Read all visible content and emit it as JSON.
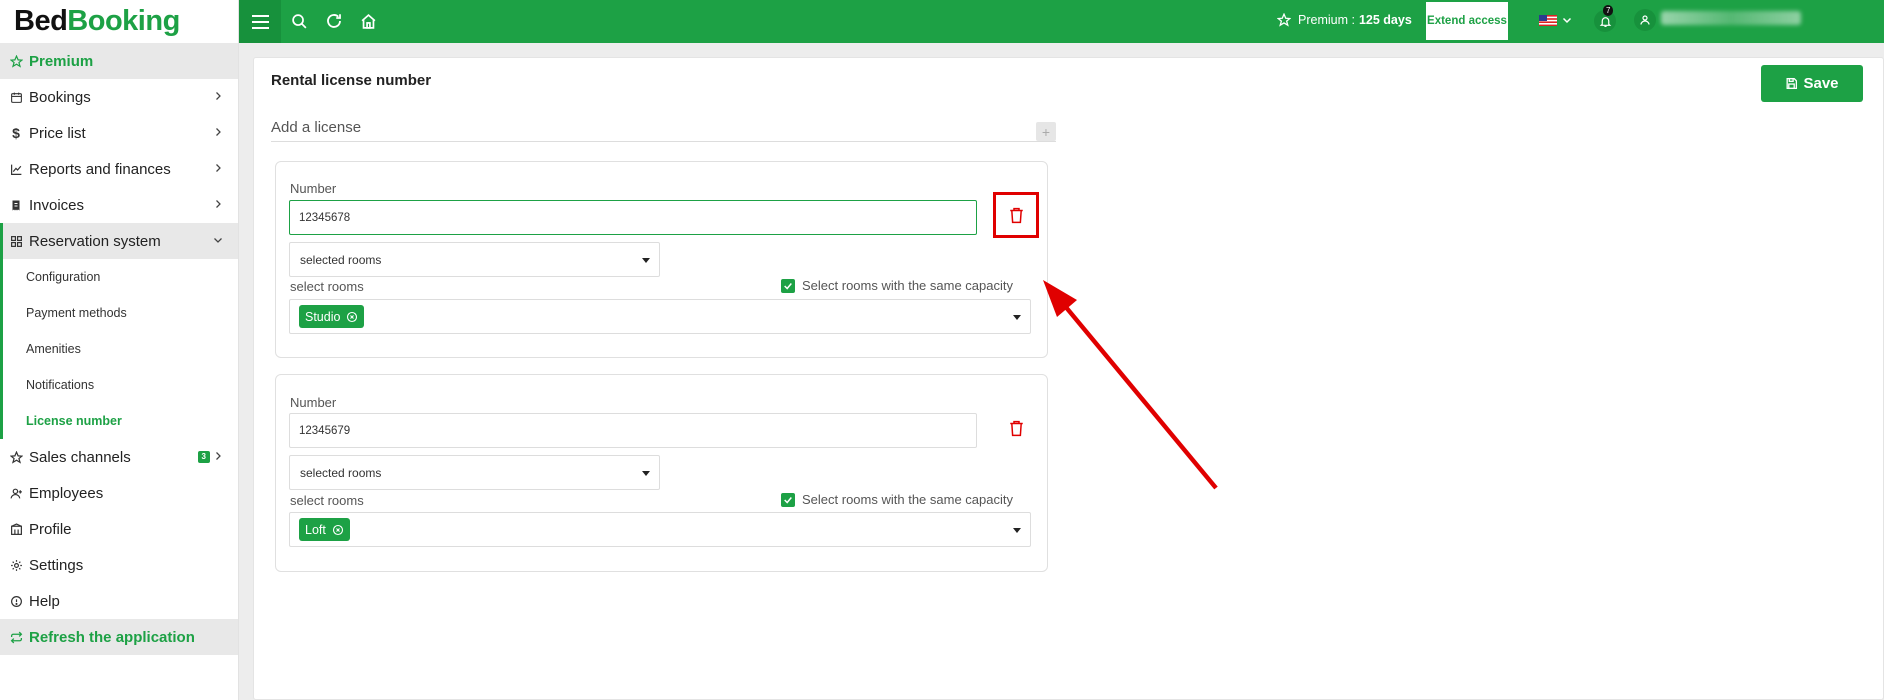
{
  "brand": {
    "part1": "Bed",
    "part2": "Booking"
  },
  "colors": {
    "accent": "#1da145",
    "accent_dark": "#17913c",
    "danger": "#e00000"
  },
  "sidebar": {
    "premium": "Premium",
    "items": [
      {
        "label": "Bookings",
        "icon": "calendar-icon"
      },
      {
        "label": "Price list",
        "icon": "dollar-icon"
      },
      {
        "label": "Reports and finances",
        "icon": "chart-icon"
      },
      {
        "label": "Invoices",
        "icon": "invoice-icon"
      },
      {
        "label": "Reservation system",
        "icon": "grid-icon"
      }
    ],
    "sub_items": [
      "Configuration",
      "Payment methods",
      "Amenities",
      "Notifications",
      "License number"
    ],
    "items2": [
      {
        "label": "Sales channels",
        "icon": "star-icon",
        "badge": "3"
      },
      {
        "label": "Employees",
        "icon": "employee-icon"
      },
      {
        "label": "Profile",
        "icon": "building-icon"
      },
      {
        "label": "Settings",
        "icon": "gear-icon"
      },
      {
        "label": "Help",
        "icon": "help-icon"
      }
    ],
    "refresh": "Refresh the application"
  },
  "topbar": {
    "premium_label": "Premium :",
    "premium_days": "125 days",
    "extend": "Extend access",
    "notifications": "7"
  },
  "page": {
    "title": "Rental license number",
    "save": "Save",
    "add_license": "Add a license",
    "add_symbol": "+"
  },
  "licenses": [
    {
      "number_label": "Number",
      "number": "12345678",
      "scope": "selected rooms",
      "rooms_label": "select rooms",
      "same_capacity": "Select rooms with the same capacity",
      "room": "Studio"
    },
    {
      "number_label": "Number",
      "number": "12345679",
      "scope": "selected rooms",
      "rooms_label": "select rooms",
      "same_capacity": "Select rooms with the same capacity",
      "room": "Loft"
    }
  ]
}
